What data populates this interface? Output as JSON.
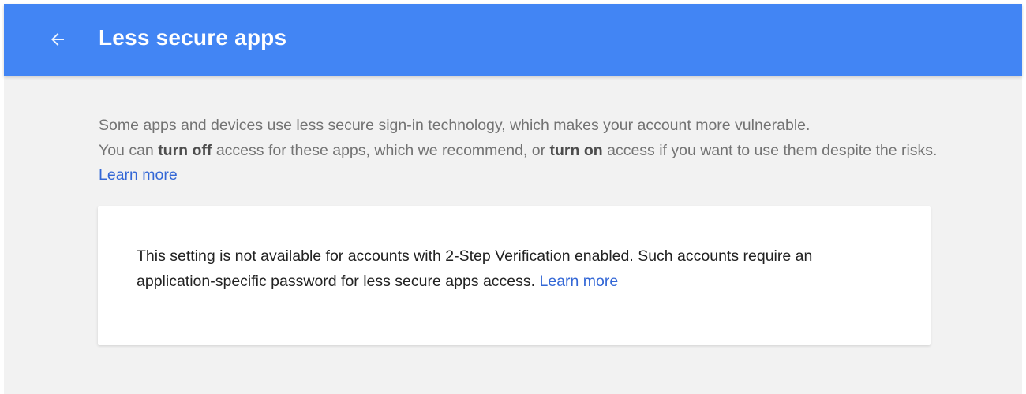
{
  "colors": {
    "header_bg": "#4285f4",
    "page_bg": "#f2f2f2",
    "link": "#3367d6"
  },
  "header": {
    "back_icon": "arrow-left-icon",
    "title": "Less secure apps"
  },
  "intro": {
    "line1": "Some apps and devices use less secure sign-in technology, which makes your account more vulnerable.",
    "part2": "You can ",
    "turn_off": "turn off",
    "part3": " access for these apps, which we recommend, or ",
    "turn_on": "turn on",
    "part4": " access if you want to use them despite the risks. ",
    "learn_more": "Learn more"
  },
  "notice": {
    "text": "This setting is not available for accounts with 2-Step Verification enabled. Such accounts require an application-specific password for less secure apps access. ",
    "learn_more": "Learn more"
  }
}
